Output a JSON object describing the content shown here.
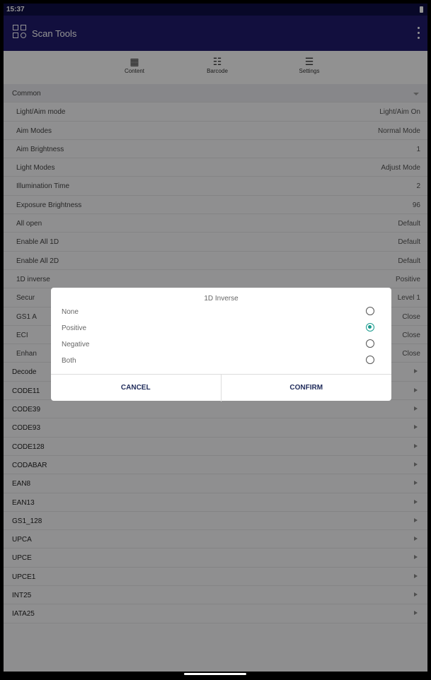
{
  "status": {
    "time": "15:37"
  },
  "appbar": {
    "title": "Scan Tools"
  },
  "tabs": [
    {
      "label": "Content"
    },
    {
      "label": "Barcode"
    },
    {
      "label": "Settings"
    }
  ],
  "section": {
    "label": "Common"
  },
  "settings": [
    {
      "label": "Light/Aim mode",
      "value": "Light/Aim On"
    },
    {
      "label": "Aim Modes",
      "value": "Normal Mode"
    },
    {
      "label": "Aim Brightness",
      "value": "1"
    },
    {
      "label": "Light Modes",
      "value": "Adjust Mode"
    },
    {
      "label": "Illumination Time",
      "value": "2"
    },
    {
      "label": "Exposure Brightness",
      "value": "96"
    },
    {
      "label": "All open",
      "value": "Default"
    },
    {
      "label": "Enable All 1D",
      "value": "Default"
    },
    {
      "label": "Enable All 2D",
      "value": "Default"
    },
    {
      "label": "1D inverse",
      "value": "Positive"
    },
    {
      "label": "Secur",
      "value": "Level 1"
    },
    {
      "label": "GS1 A",
      "value": "Close"
    },
    {
      "label": "ECI",
      "value": "Close"
    },
    {
      "label": "Enhan",
      "value": "Close"
    }
  ],
  "groups": [
    "Decode",
    "CODE11",
    "CODE39",
    "CODE93",
    "CODE128",
    "CODABAR",
    "EAN8",
    "EAN13",
    "GS1_128",
    "UPCA",
    "UPCE",
    "UPCE1",
    "INT25",
    "IATA25"
  ],
  "dialog": {
    "title": "1D Inverse",
    "options": [
      {
        "label": "None",
        "selected": false
      },
      {
        "label": "Positive",
        "selected": true
      },
      {
        "label": "Negative",
        "selected": false
      },
      {
        "label": "Both",
        "selected": false
      }
    ],
    "cancel": "CANCEL",
    "confirm": "CONFIRM"
  },
  "colors": {
    "appbar": "#1f1a6b",
    "status": "#0f0e45",
    "accent": "#1a9b8e",
    "button_text": "#1e2a5a"
  },
  "icons": {
    "logo": "scan-logo-icon",
    "more": "more-vert-icon",
    "content": "qr-code-icon",
    "barcode": "barcode-list-icon",
    "settings": "sliders-icon"
  }
}
